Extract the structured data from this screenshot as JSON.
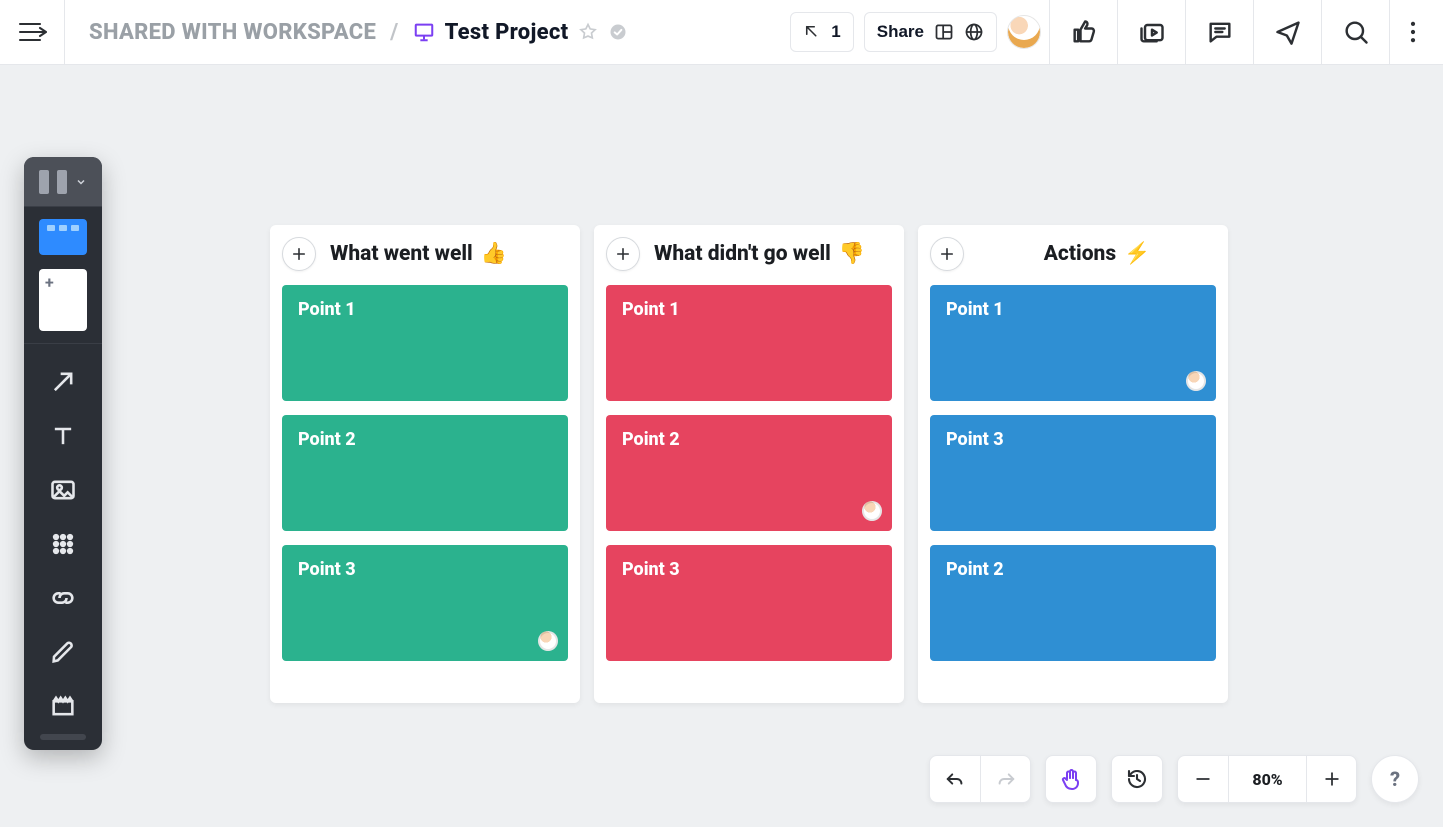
{
  "breadcrumb": {
    "shared_label": "SHARED WITH WORKSPACE",
    "project_title": "Test Project"
  },
  "header": {
    "present_count": "1",
    "share_label": "Share"
  },
  "columns": [
    {
      "title": "What went well",
      "emoji": "👍",
      "color": "c-green",
      "cards": [
        {
          "label": "Point 1",
          "avatar": false
        },
        {
          "label": "Point 2",
          "avatar": false
        },
        {
          "label": "Point 3",
          "avatar": true
        }
      ]
    },
    {
      "title": "What didn't go well",
      "emoji": "👎",
      "color": "c-red",
      "cards": [
        {
          "label": "Point 1",
          "avatar": false
        },
        {
          "label": "Point 2",
          "avatar": true
        },
        {
          "label": "Point 3",
          "avatar": false
        }
      ]
    },
    {
      "title": "Actions",
      "emoji": "⚡",
      "color": "c-blue",
      "center": true,
      "cards": [
        {
          "label": "Point 1",
          "avatar": true
        },
        {
          "label": "Point 3",
          "avatar": false
        },
        {
          "label": "Point 2",
          "avatar": false
        }
      ]
    }
  ],
  "zoom": {
    "level": "80%"
  },
  "help": {
    "label": "?"
  }
}
